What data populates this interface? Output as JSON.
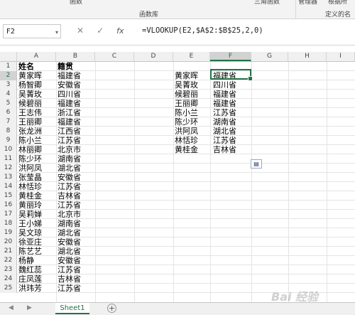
{
  "ribbon": {
    "top_items": [
      "函数",
      "三角函数",
      "管理器",
      "根据所"
    ],
    "group_label": "函数库",
    "right_group_label": "定义的名"
  },
  "namebox": "F2",
  "formula_bar": {
    "cancel": "✕",
    "enter": "✓",
    "fx": "fx",
    "formula": "=VLOOKUP(E2,$A$2:$B$25,2,0)"
  },
  "columns": [
    "A",
    "B",
    "C",
    "D",
    "E",
    "F",
    "G",
    "H",
    "I"
  ],
  "selected_column": "F",
  "rows": [
    "1",
    "2",
    "3",
    "4",
    "5",
    "6",
    "7",
    "8",
    "9",
    "10",
    "11",
    "12",
    "13",
    "14",
    "15",
    "16",
    "17",
    "18",
    "19",
    "20",
    "21",
    "22",
    "23",
    "24",
    "25"
  ],
  "selected_row": "2",
  "table_ab": [
    [
      "姓名",
      "籍贯"
    ],
    [
      "黄家晖",
      "福建省"
    ],
    [
      "杨智卿",
      "安徽省"
    ],
    [
      "吴菁玫",
      "四川省"
    ],
    [
      "候碧丽",
      "福建省"
    ],
    [
      "王志伟",
      "浙江省"
    ],
    [
      "王丽卿",
      "福建省"
    ],
    [
      "张龙洲",
      "江西省"
    ],
    [
      "陈小兰",
      "江苏省"
    ],
    [
      "林丽卿",
      "北京市"
    ],
    [
      "陈少环",
      "湖南省"
    ],
    [
      "洪阿凤",
      "湖北省"
    ],
    [
      "张莹晶",
      "安徽省"
    ],
    [
      "林恬珍",
      "江苏省"
    ],
    [
      "黄桂金",
      "吉林省"
    ],
    [
      "黄丽玲",
      "江苏省"
    ],
    [
      "吴莉婵",
      "北京市"
    ],
    [
      "王小娣",
      "湖南省"
    ],
    [
      "吴文琼",
      "湖北省"
    ],
    [
      "徐亚庄",
      "安徽省"
    ],
    [
      "陈艺艺",
      "湖北省"
    ],
    [
      "杨静",
      "安徽省"
    ],
    [
      "魏红蕊",
      "江苏省"
    ],
    [
      "庄凤莲",
      "吉林省"
    ],
    [
      "洪玮芳",
      "江苏省"
    ]
  ],
  "table_ef": [
    [
      "黄家晖",
      "福建省"
    ],
    [
      "吴菁玫",
      "四川省"
    ],
    [
      "候碧丽",
      "福建省"
    ],
    [
      "王丽卿",
      "福建省"
    ],
    [
      "陈小兰",
      "江苏省"
    ],
    [
      "陈少环",
      "湖南省"
    ],
    [
      "洪阿凤",
      "湖北省"
    ],
    [
      "林恬珍",
      "江苏省"
    ],
    [
      "黄桂金",
      "吉林省"
    ]
  ],
  "sheet_tab": "Sheet1",
  "add_sheet": "+",
  "watermark": "Bai 经验"
}
